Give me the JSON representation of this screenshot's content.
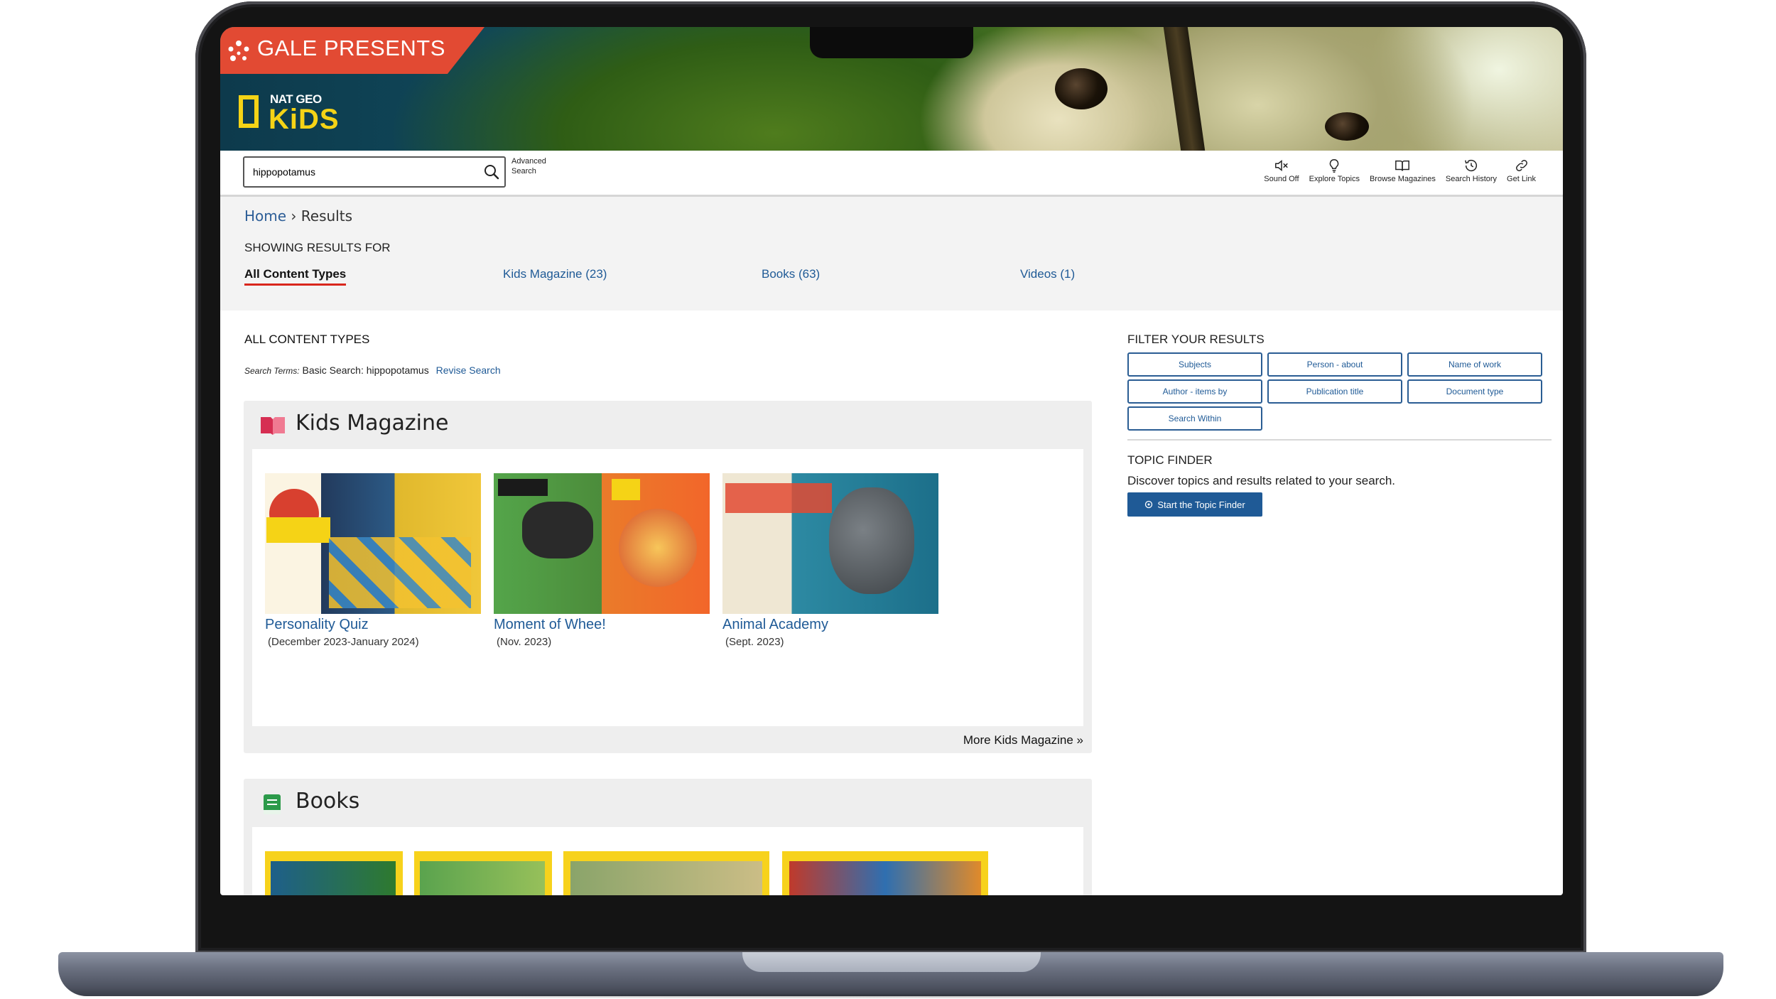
{
  "brand": {
    "presenter": "GALE PRESENTS",
    "logo_top": "NAT GEO",
    "logo_main": "KiDS"
  },
  "search": {
    "value": "hippopotamus",
    "advanced_label": "Advanced Search"
  },
  "tools": [
    {
      "label": "Sound Off",
      "icon": "speaker-mute-icon"
    },
    {
      "label": "Explore Topics",
      "icon": "lightbulb-icon"
    },
    {
      "label": "Browse Magazines",
      "icon": "open-book-icon"
    },
    {
      "label": "Search History",
      "icon": "history-icon"
    },
    {
      "label": "Get Link",
      "icon": "link-icon"
    }
  ],
  "breadcrumb": {
    "home": "Home",
    "separator": "›",
    "current": "Results"
  },
  "showing_label": "SHOWING RESULTS FOR",
  "content_tabs": [
    {
      "label": "All Content Types",
      "active": true
    },
    {
      "label": "Kids Magazine  (23)",
      "active": false
    },
    {
      "label": "Books  (63)",
      "active": false
    },
    {
      "label": "Videos  (1)",
      "active": false
    }
  ],
  "results": {
    "heading": "ALL CONTENT TYPES",
    "terms_label": "Search Terms:",
    "terms_type": "Basic Search:",
    "terms_value": "hippopotamus",
    "revise": "Revise Search"
  },
  "kids_magazine": {
    "title": "Kids Magazine",
    "more": "More Kids Magazine »",
    "items": [
      {
        "title": "Personality Quiz",
        "date": "(December 2023-January 2024)"
      },
      {
        "title": "Moment of Whee!",
        "date": "(Nov. 2023)"
      },
      {
        "title": "Animal Academy",
        "date": "(Sept. 2023)"
      }
    ]
  },
  "books": {
    "title": "Books"
  },
  "filters": {
    "title": "FILTER YOUR RESULTS",
    "buttons": [
      "Subjects",
      "Person - about",
      "Name of work",
      "Author - items by",
      "Publication title",
      "Document type",
      "Search Within"
    ]
  },
  "topic_finder": {
    "title": "TOPIC FINDER",
    "description": "Discover topics and results related to your search.",
    "button": "Start the Topic Finder"
  },
  "colors": {
    "accent_red": "#e24a33",
    "link_blue": "#1f5a96",
    "natgeo_yellow": "#f5d316",
    "tab_underline": "#d9261c"
  }
}
